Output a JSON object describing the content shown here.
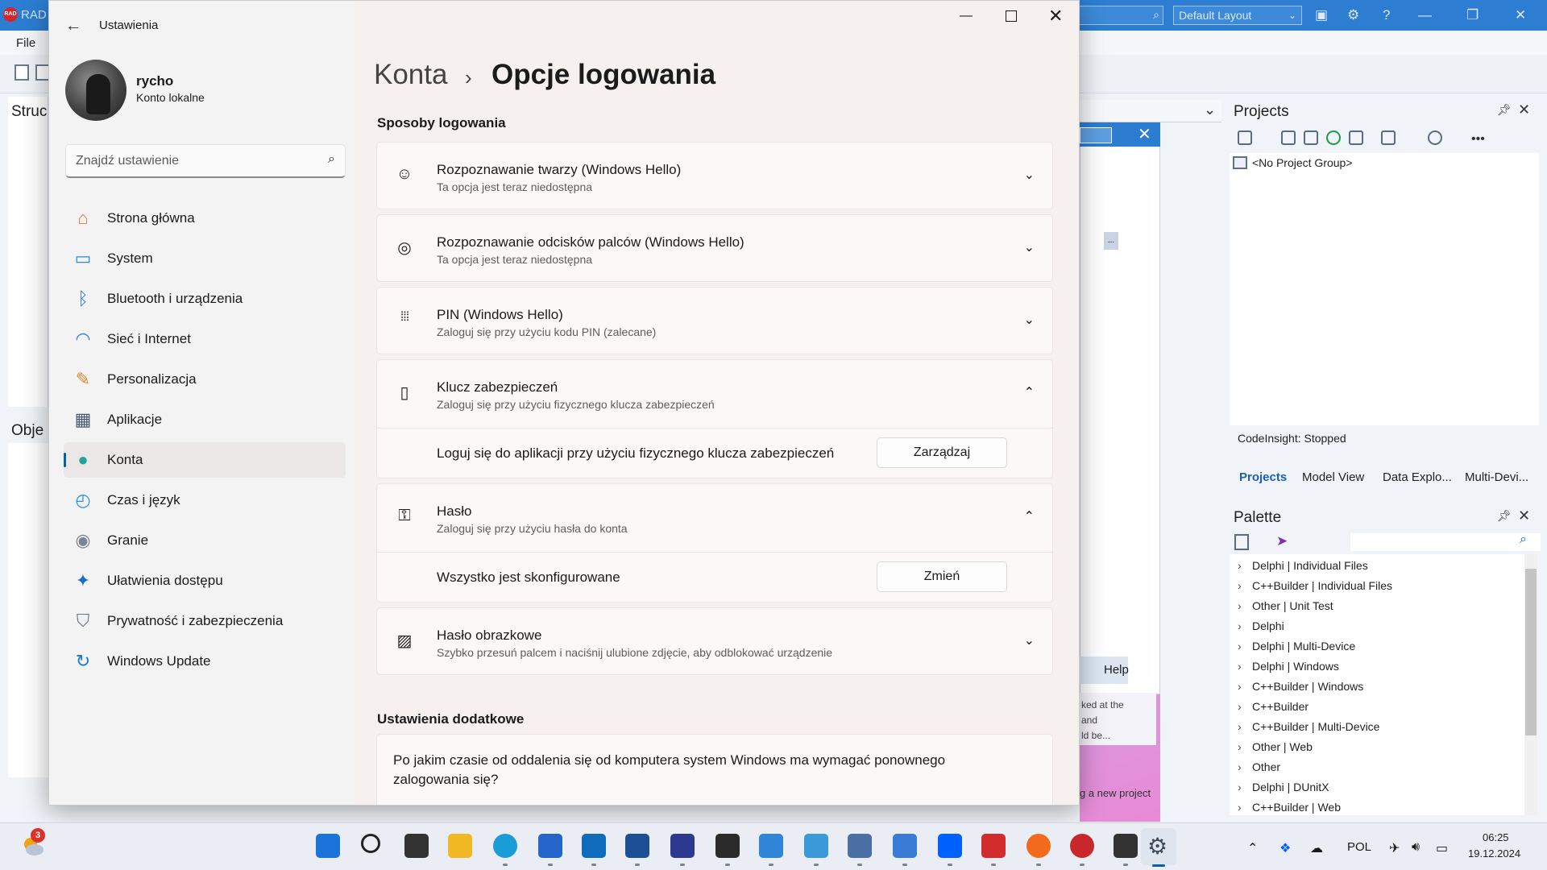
{
  "ide": {
    "title": "RAD",
    "menu_file": "File",
    "layout_select": "Default Layout",
    "left_struct": "Struc",
    "left_obj": "Obje",
    "help_button": "Help",
    "hint_lines": [
      "ked at the",
      "and",
      "ld be..."
    ],
    "new_project_hint": "g a new project",
    "dialog_more": "...",
    "projects": {
      "title": "Projects",
      "node": "<No Project Group>",
      "codeinsight": "CodeInsight: Stopped",
      "tabs": [
        "Projects",
        "Model View",
        "Data Explo...",
        "Multi-Devi..."
      ]
    },
    "palette": {
      "title": "Palette",
      "items": [
        "Delphi | Individual Files",
        "C++Builder | Individual Files",
        "Other | Unit Test",
        "Delphi",
        "Delphi | Multi-Device",
        "Delphi | Windows",
        "C++Builder | Windows",
        "C++Builder",
        "C++Builder | Multi-Device",
        "Other | Web",
        "Other",
        "Delphi | DUnitX",
        "C++Builder | Web"
      ]
    }
  },
  "settings": {
    "window_title": "Ustawienia",
    "user_name": "rycho",
    "user_type": "Konto lokalne",
    "search_placeholder": "Znajdź ustawienie",
    "nav": [
      {
        "label": "Strona główna",
        "icon": "home-icon",
        "color": "#e8734a"
      },
      {
        "label": "System",
        "icon": "system-icon",
        "color": "#2f8ad8"
      },
      {
        "label": "Bluetooth i urządzenia",
        "icon": "bluetooth-icon",
        "color": "#2b7fd6"
      },
      {
        "label": "Sieć i Internet",
        "icon": "wifi-icon",
        "color": "#2b7fd6"
      },
      {
        "label": "Personalizacja",
        "icon": "brush-icon",
        "color": "#e0862f"
      },
      {
        "label": "Aplikacje",
        "icon": "apps-icon",
        "color": "#4a5a72"
      },
      {
        "label": "Konta",
        "icon": "person-icon",
        "color": "#1fa39a"
      },
      {
        "label": "Czas i język",
        "icon": "globe-clock-icon",
        "color": "#2b8fe0"
      },
      {
        "label": "Granie",
        "icon": "gamepad-icon",
        "color": "#7a8595"
      },
      {
        "label": "Ułatwienia dostępu",
        "icon": "accessibility-icon",
        "color": "#1a6fd0"
      },
      {
        "label": "Prywatność i zabezpieczenia",
        "icon": "shield-icon",
        "color": "#6b7685"
      },
      {
        "label": "Windows Update",
        "icon": "update-icon",
        "color": "#1a79d4"
      }
    ],
    "breadcrumb_parent": "Konta",
    "breadcrumb_sep": "›",
    "page_title": "Opcje logowania",
    "section_title": "Sposoby logowania",
    "methods": [
      {
        "title": "Rozpoznawanie twarzy (Windows Hello)",
        "subtitle": "Ta opcja jest teraz niedostępna"
      },
      {
        "title": "Rozpoznawanie odcisków palców (Windows Hello)",
        "subtitle": "Ta opcja jest teraz niedostępna"
      },
      {
        "title": "PIN (Windows Hello)",
        "subtitle": "Zaloguj się przy użyciu kodu PIN (zalecane)"
      },
      {
        "title": "Klucz zabezpieczeń",
        "subtitle": "Zaloguj się przy użyciu fizycznego klucza zabezpieczeń",
        "row_text": "Loguj się do aplikacji przy użyciu fizycznego klucza zabezpieczeń",
        "button": "Zarządzaj"
      },
      {
        "title": "Hasło",
        "subtitle": "Zaloguj się przy użyciu hasła do konta",
        "row_text": "Wszystko jest skonfigurowane",
        "button": "Zmień"
      },
      {
        "title": "Hasło obrazkowe",
        "subtitle": "Szybko przesuń palcem i naciśnij ulubione zdjęcie, aby odblokować urządzenie"
      }
    ],
    "section2_title": "Ustawienia dodatkowe",
    "extra_question": "Po jakim czasie od oddalenia się od komputera system Windows ma wymagać ponownego zalogowania się?"
  },
  "taskbar": {
    "weather_badge": "3",
    "language": "POL",
    "time": "06:25",
    "date": "19.12.2024"
  }
}
